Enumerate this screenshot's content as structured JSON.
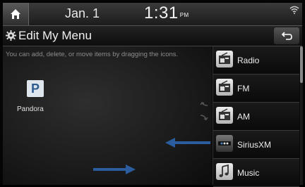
{
  "status": {
    "date": "Jan.  1",
    "time": "1:31",
    "meridiem": "PM"
  },
  "header": {
    "title": "Edit My Menu"
  },
  "hint_text": "You can add, delete, or move items by dragging the icons.",
  "available_items": [
    {
      "label": "Pandora",
      "icon": "pandora-icon",
      "glyph": "P"
    }
  ],
  "menu_items": [
    {
      "label": "Radio",
      "icon": "radio-icon"
    },
    {
      "label": "FM",
      "icon": "radio-icon"
    },
    {
      "label": "AM",
      "icon": "radio-icon"
    },
    {
      "label": "SiriusXM",
      "icon": "siriusxm-icon"
    },
    {
      "label": "Music",
      "icon": "music-icon"
    }
  ],
  "colors": {
    "accent_arrow": "#2a5c9e",
    "pandora_blue": "#2b5d91"
  }
}
